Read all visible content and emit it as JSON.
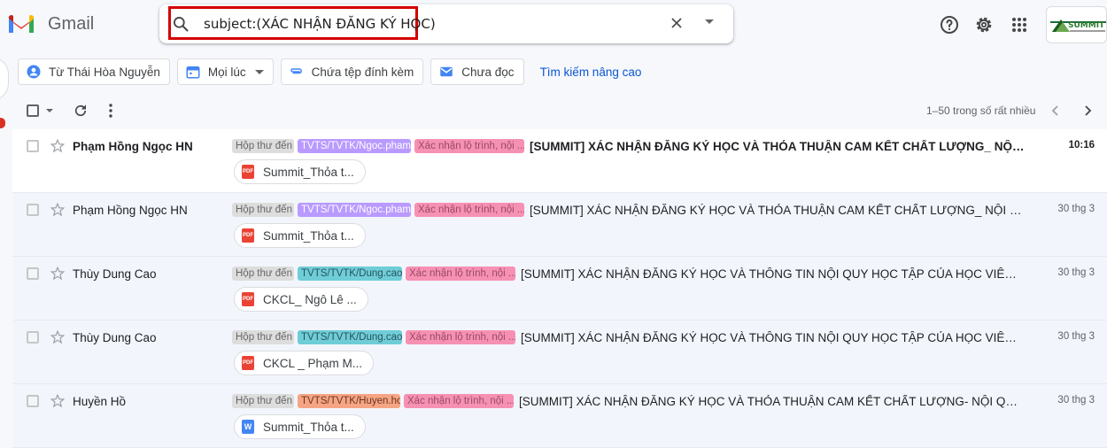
{
  "app": {
    "name": "Gmail"
  },
  "search": {
    "query": "subject:(XÁC NHẬN ĐĂNG KÝ HỌC)"
  },
  "header_icons": [
    "help-icon",
    "settings-icon",
    "apps-icon"
  ],
  "account": {
    "badge_text": "SUMMIT"
  },
  "filters": [
    {
      "label": "Từ Thái Hòa Nguyễn",
      "icon": "person-icon",
      "dropdown": false
    },
    {
      "label": "Mọi lúc",
      "icon": "calendar-icon",
      "dropdown": true
    },
    {
      "label": "Chứa tệp đính kèm",
      "icon": "paperclip-icon",
      "dropdown": false
    },
    {
      "label": "Chưa đọc",
      "icon": "mail-icon",
      "dropdown": false
    }
  ],
  "advanced_search": "Tìm kiếm nâng cao",
  "pagination": {
    "text": "1–50 trong số rất nhiều"
  },
  "colors": {
    "accent": "#0b57d0",
    "highlight": "#d50000"
  },
  "emails": [
    {
      "sender": "Phạm Hồng Ngọc HN",
      "unread": true,
      "labels": [
        {
          "text": "Hộp thư đến",
          "kind": "inbox"
        },
        {
          "text": "TVTS/TVTK/Ngoc.pham",
          "kind": "user",
          "bg": "#b99aff",
          "fg": "#ffffff"
        },
        {
          "text": "Xác nhận lộ trình, nội ...",
          "kind": "reg"
        }
      ],
      "subject": "[SUMMIT] XÁC NHẬN ĐĂNG KÝ HỌC VÀ THỎA THUẬN CAM KẾT CHẤT LƯỢNG_ NỘI QUY HỌ...",
      "date": "10:16",
      "attachment": {
        "name": "Summit_Thỏa t...",
        "type": "pdf"
      }
    },
    {
      "sender": "Phạm Hồng Ngọc HN",
      "unread": false,
      "labels": [
        {
          "text": "Hộp thư đến",
          "kind": "inbox"
        },
        {
          "text": "TVTS/TVTK/Ngoc.pham",
          "kind": "user",
          "bg": "#b99aff",
          "fg": "#ffffff"
        },
        {
          "text": "Xác nhận lộ trình, nội ...",
          "kind": "reg"
        }
      ],
      "subject": "[SUMMIT] XÁC NHẬN ĐĂNG KÝ HỌC VÀ THỎA THUẬN CAM KẾT CHẤT LƯỢNG_ NỘI QUY HỌ...",
      "date": "30 thg 3",
      "attachment": {
        "name": "Summit_Thỏa t...",
        "type": "pdf"
      }
    },
    {
      "sender": "Thùy Dung Cao",
      "unread": false,
      "labels": [
        {
          "text": "Hộp thư đến",
          "kind": "inbox"
        },
        {
          "text": "TVTS/TVTK/Dung.cao",
          "kind": "user",
          "bg": "#6fcdd8",
          "fg": "#28545a"
        },
        {
          "text": "Xác nhận lộ trình, nội ...",
          "kind": "reg"
        }
      ],
      "subject": "[SUMMIT] XÁC NHẬN ĐĂNG KÝ HỌC VÀ THÔNG TIN NỘI QUY HỌC TẬP CỦA HỌC VIÊN _ Ngô L...",
      "date": "30 thg 3",
      "attachment": {
        "name": "CKCL_ Ngô Lê ...",
        "type": "pdf"
      }
    },
    {
      "sender": "Thùy Dung Cao",
      "unread": false,
      "labels": [
        {
          "text": "Hộp thư đến",
          "kind": "inbox"
        },
        {
          "text": "TVTS/TVTK/Dung.cao",
          "kind": "user",
          "bg": "#6fcdd8",
          "fg": "#28545a"
        },
        {
          "text": "Xác nhận lộ trình, nội ...",
          "kind": "reg"
        }
      ],
      "subject": "[SUMMIT] XÁC NHẬN ĐĂNG KÝ HỌC VÀ THÔNG TIN NỘI QUY HỌC TẬP CỦA HỌC VIÊN _ Phạm ...",
      "date": "30 thg 3",
      "attachment": {
        "name": "CKCL _ Phạm M...",
        "type": "pdf"
      }
    },
    {
      "sender": "Huyền Hồ",
      "unread": false,
      "labels": [
        {
          "text": "Hộp thư đến",
          "kind": "inbox"
        },
        {
          "text": "TVTS/TVTK/Huyen.ho",
          "kind": "user",
          "bg": "#f6a584",
          "fg": "#6b3520"
        },
        {
          "text": "Xác nhận lộ trình, nội ...",
          "kind": "reg"
        }
      ],
      "subject": "[SUMMIT] XÁC NHẬN ĐĂNG KÝ HỌC VÀ THỎA THUẬN CAM KẾT CHẤT LƯỢNG- NỘI QUY HỌC T...",
      "date": "30 thg 3",
      "attachment": {
        "name": "Summit_Thỏa t...",
        "type": "doc"
      }
    }
  ]
}
